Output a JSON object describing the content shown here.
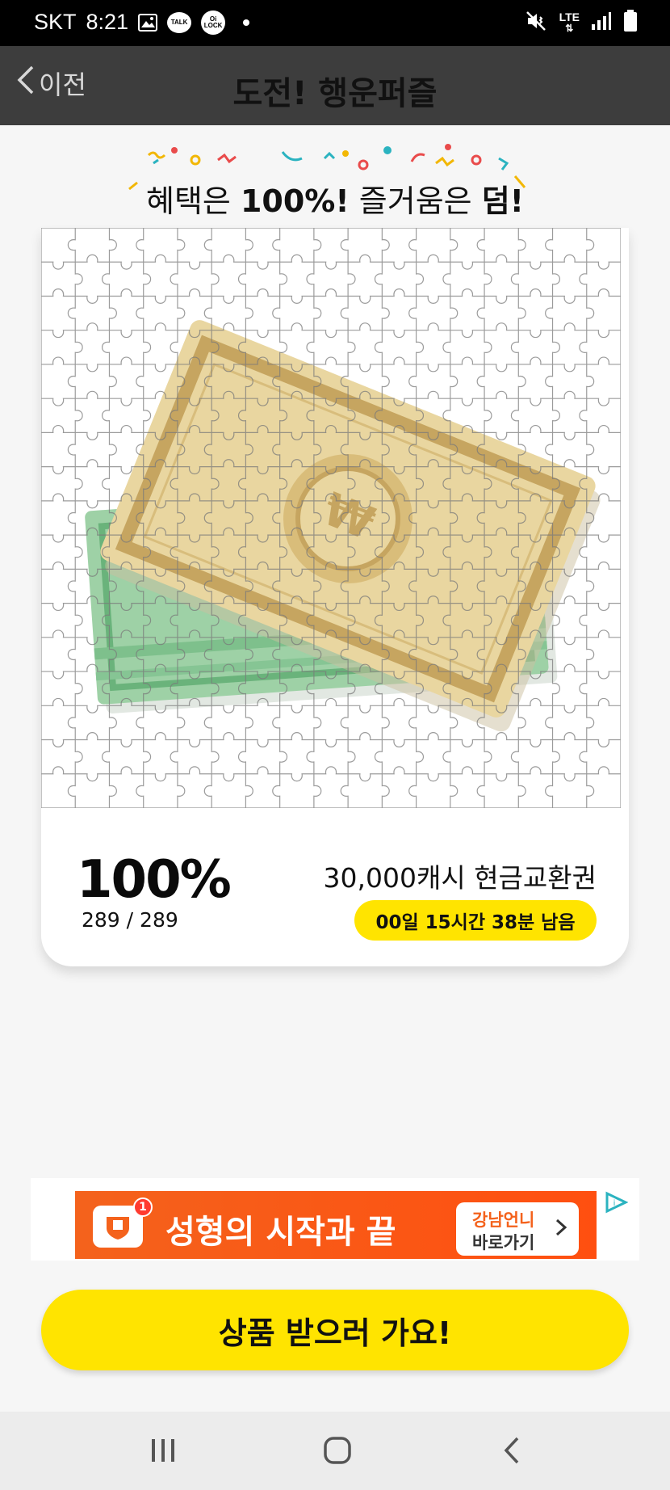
{
  "status_bar": {
    "carrier": "SKT",
    "time": "8:21",
    "talk_label": "TALK",
    "lock_label": "Oi LOCK",
    "network": "LTE",
    "icons": [
      "image-icon",
      "kakaotalk-icon",
      "oilock-icon",
      "mute-icon",
      "signal-icon",
      "battery-icon"
    ]
  },
  "header": {
    "back_label": "이전",
    "title": "도전! 행운퍼즐"
  },
  "slogan": {
    "part1": "혜택은 ",
    "part2": "100%!",
    "part3": " 즐거움은 ",
    "part4": "덤!"
  },
  "puzzle": {
    "prize_image": "cash-voucher-illustration",
    "rows": 17,
    "cols": 17
  },
  "progress": {
    "percent_label": "100%",
    "count_label": "289 / 289",
    "completed": 289,
    "total": 289
  },
  "prize": {
    "name": "30,000캐시 현금교환권",
    "time_left": "00일 15시간 38분 남음"
  },
  "ad": {
    "badge": "1",
    "headline": "성형의 시작과 끝",
    "cta_line1": "강남언니",
    "cta_line2": "바로가기"
  },
  "cta": {
    "label": "상품 받으러 가요!"
  },
  "colors": {
    "accent": "#ffe400",
    "header_bg": "#3d3d3d",
    "ad_bg": "#f4621c"
  }
}
